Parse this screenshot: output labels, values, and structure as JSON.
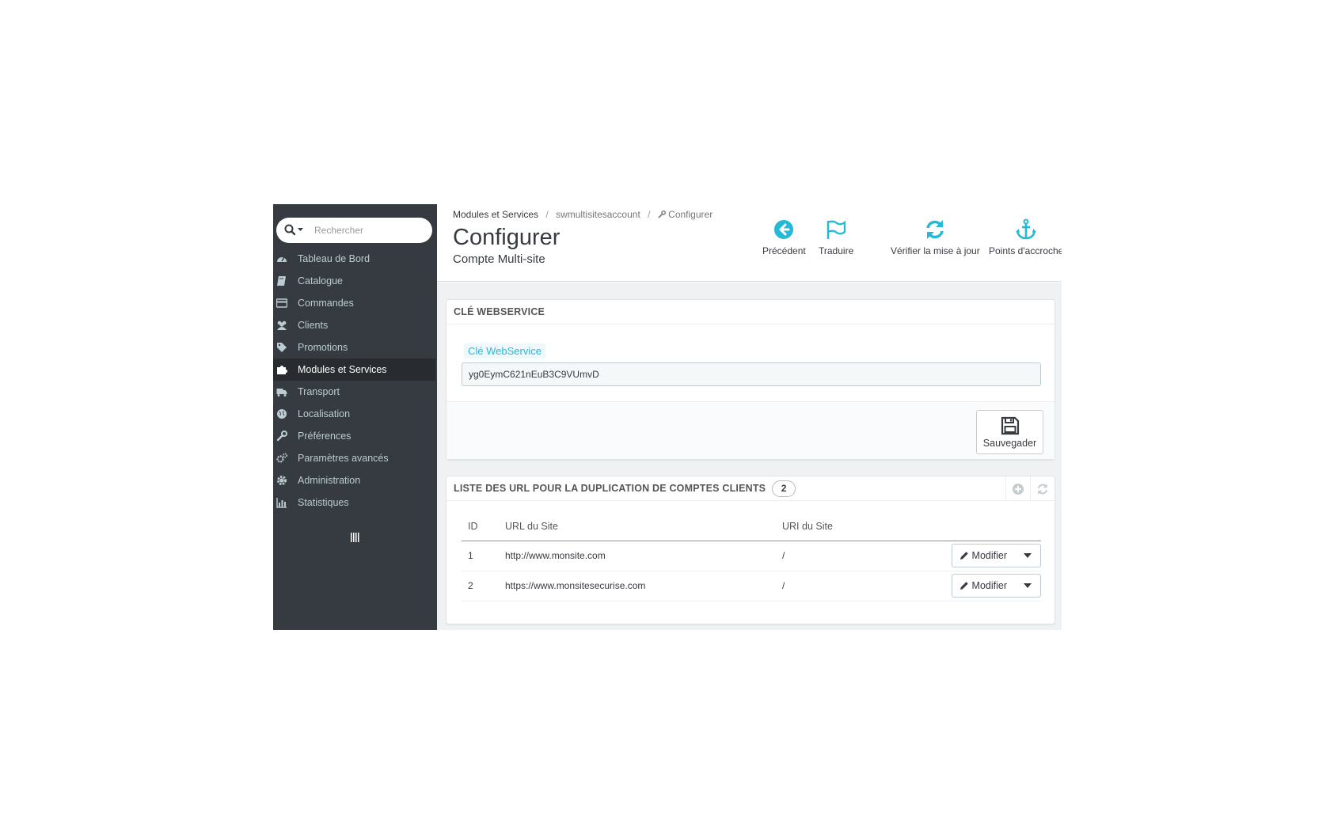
{
  "search": {
    "placeholder": "Rechercher"
  },
  "sidebar": {
    "items": [
      {
        "label": "Tableau de Bord",
        "icon": "dashboard-icon"
      },
      {
        "label": "Catalogue",
        "icon": "book-icon"
      },
      {
        "label": "Commandes",
        "icon": "credit-card-icon"
      },
      {
        "label": "Clients",
        "icon": "users-icon"
      },
      {
        "label": "Promotions",
        "icon": "tags-icon"
      },
      {
        "label": "Modules et Services",
        "icon": "puzzle-icon"
      },
      {
        "label": "Transport",
        "icon": "truck-icon"
      },
      {
        "label": "Localisation",
        "icon": "globe-icon"
      },
      {
        "label": "Préférences",
        "icon": "wrench-icon"
      },
      {
        "label": "Paramètres avancés",
        "icon": "cogs-icon"
      },
      {
        "label": "Administration",
        "icon": "gear-icon"
      },
      {
        "label": "Statistiques",
        "icon": "bar-chart-icon"
      }
    ],
    "active_index": 5
  },
  "breadcrumb": {
    "item1": "Modules et Services",
    "item2": "swmultisitesaccount",
    "item3": "Configurer"
  },
  "page": {
    "title": "Configurer",
    "subtitle": "Compte Multi-site"
  },
  "toolbar": {
    "back": "Précédent",
    "translate": "Traduire",
    "check_update": "Vérifier la mise à jour",
    "hooks": "Points d'accroche"
  },
  "webservice_panel": {
    "heading": "CLÉ WEBSERVICE",
    "field_label": "Clé WebService",
    "field_value": "yg0EymC621nEuB3C9VUmvD",
    "save_label": "Sauvegader"
  },
  "url_panel": {
    "heading": "LISTE DES URL POUR LA DUPLICATION DE COMPTES CLIENTS",
    "count": "2",
    "columns": {
      "id": "ID",
      "url": "URL du Site",
      "uri": "URI du Site"
    },
    "rows": [
      {
        "id": "1",
        "url": "http://www.monsite.com",
        "uri": "/",
        "action": "Modifier"
      },
      {
        "id": "2",
        "url": "https://www.monsitesecurise.com",
        "uri": "/",
        "action": "Modifier"
      }
    ]
  },
  "colors": {
    "accent": "#25b9d7",
    "sidebar": "#363a41",
    "sidebar_active": "#282b30"
  }
}
